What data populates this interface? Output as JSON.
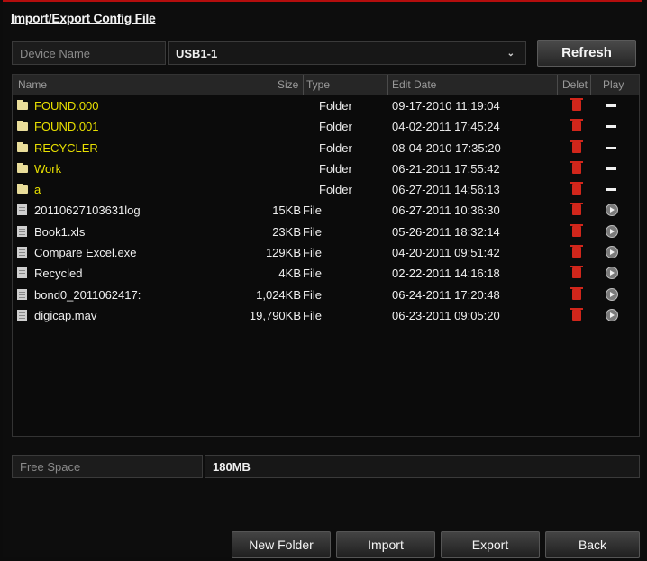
{
  "dialog": {
    "title": "Import/Export Config File"
  },
  "device": {
    "label": "Device Name",
    "value": "USB1-1",
    "refresh_label": "Refresh"
  },
  "table": {
    "headers": {
      "name": "Name",
      "size": "Size",
      "type": "Type",
      "edit_date": "Edit Date",
      "delete": "Delet",
      "play": "Play"
    },
    "rows": [
      {
        "name": "FOUND.000",
        "size": "",
        "type": "Folder",
        "date": "09-17-2010 11:19:04",
        "kind": "folder"
      },
      {
        "name": "FOUND.001",
        "size": "",
        "type": "Folder",
        "date": "04-02-2011 17:45:24",
        "kind": "folder"
      },
      {
        "name": "RECYCLER",
        "size": "",
        "type": "Folder",
        "date": "08-04-2010 17:35:20",
        "kind": "folder"
      },
      {
        "name": "Work",
        "size": "",
        "type": "Folder",
        "date": "06-21-2011 17:55:42",
        "kind": "folder"
      },
      {
        "name": "a",
        "size": "",
        "type": "Folder",
        "date": "06-27-2011 14:56:13",
        "kind": "folder"
      },
      {
        "name": "20110627103631log",
        "size": "15KB",
        "type": "File",
        "date": "06-27-2011 10:36:30",
        "kind": "file"
      },
      {
        "name": "Book1.xls",
        "size": "23KB",
        "type": "File",
        "date": "05-26-2011 18:32:14",
        "kind": "file"
      },
      {
        "name": "Compare Excel.exe",
        "size": "129KB",
        "type": "File",
        "date": "04-20-2011 09:51:42",
        "kind": "file"
      },
      {
        "name": "Recycled",
        "size": "4KB",
        "type": "File",
        "date": "02-22-2011 14:16:18",
        "kind": "file"
      },
      {
        "name": "bond0_2011062417:",
        "size": "1,024KB",
        "type": "File",
        "date": "06-24-2011 17:20:48",
        "kind": "file"
      },
      {
        "name": "digicap.mav",
        "size": "19,790KB",
        "type": "File",
        "date": "06-23-2011 09:05:20",
        "kind": "file"
      }
    ]
  },
  "free_space": {
    "label": "Free Space",
    "value": "180MB"
  },
  "buttons": {
    "new_folder": "New Folder",
    "import": "Import",
    "export": "Export",
    "back": "Back"
  },
  "icons": {
    "folder": "folder-icon",
    "file": "file-icon",
    "delete": "trash-icon",
    "folder_play": "dash-icon",
    "file_play": "play-icon"
  },
  "colors": {
    "accent_top": "#b30d0d",
    "folder_text": "#e8e000",
    "delete_icon": "#d1261b"
  }
}
